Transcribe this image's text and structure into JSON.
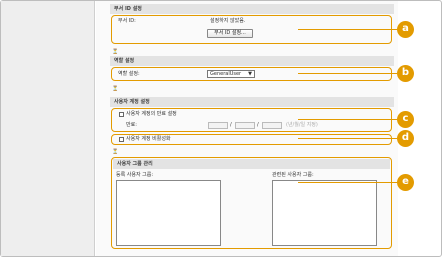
{
  "department_id": {
    "section_title": "부서 ID 설정",
    "label": "부서 ID:",
    "value": "설정하지 않았음.",
    "button": "부서 ID 설정..."
  },
  "role": {
    "section_title": "역할 설정",
    "label": "역할 설정:",
    "selected": "GeneralUser"
  },
  "account": {
    "section_title": "사용자 계정 설정",
    "expiry_checkbox": "사용자 계정의 만료 설정",
    "expiry_label": "만료:",
    "date_sep1": "/",
    "date_sep2": "/",
    "date_hint": "(년/월/일 지정)",
    "disable_checkbox": "사용자 계정 비활성화"
  },
  "groups": {
    "section_title": "사용자 그룹 관리",
    "registered_label": "등록 사용자 그룹:",
    "related_label": "관련된 사용자 그룹:"
  },
  "divider_icon": "⏳",
  "callouts": [
    "a",
    "b",
    "c",
    "d",
    "e"
  ],
  "accent_color": "#e39b00"
}
